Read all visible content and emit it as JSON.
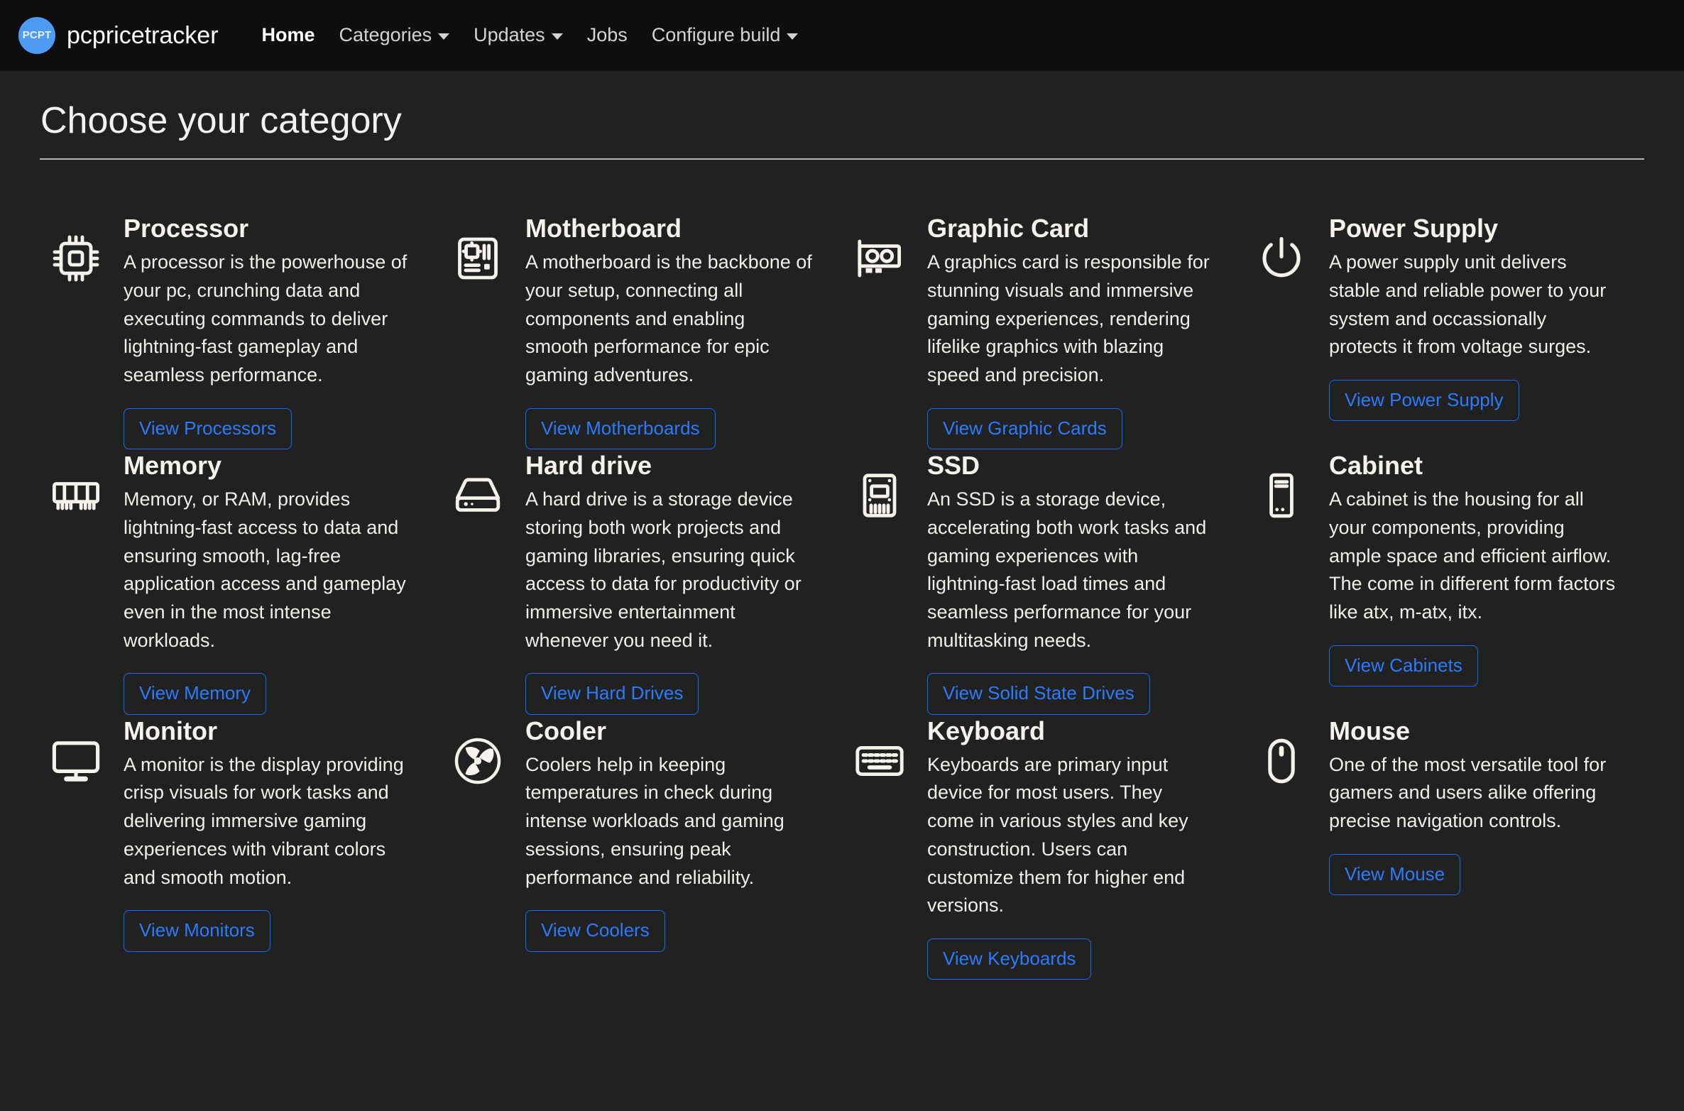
{
  "navbar": {
    "logo_text": "PCPT",
    "brand": "pcpricetracker",
    "logo_color": "#4d9bf5",
    "items": [
      {
        "label": "Home",
        "active": true,
        "dropdown": false
      },
      {
        "label": "Categories",
        "active": false,
        "dropdown": true
      },
      {
        "label": "Updates",
        "active": false,
        "dropdown": true
      },
      {
        "label": "Jobs",
        "active": false,
        "dropdown": false
      },
      {
        "label": "Configure build",
        "active": false,
        "dropdown": true
      }
    ]
  },
  "page": {
    "title": "Choose your category",
    "accent_color": "#0d6efd",
    "background": "#212121",
    "navbar_background": "#0e0e0e"
  },
  "categories": [
    {
      "icon": "cpu-icon",
      "title": "Processor",
      "description": "A processor is the powerhouse of your pc, crunching data and executing commands to deliver lightning-fast gameplay and seamless performance.",
      "button": "View Processors"
    },
    {
      "icon": "motherboard-icon",
      "title": "Motherboard",
      "description": "A motherboard is the backbone of your setup, connecting all components and enabling smooth performance for epic gaming adventures.",
      "button": "View Motherboards"
    },
    {
      "icon": "graphics-card-icon",
      "title": "Graphic Card",
      "description": "A graphics card is responsible for stunning visuals and immersive gaming experiences, rendering lifelike graphics with blazing speed and precision.",
      "button": "View Graphic Cards"
    },
    {
      "icon": "power-icon",
      "title": "Power Supply",
      "description": "A power supply unit delivers stable and reliable power to your system and occassionally protects it from voltage surges.",
      "button": "View Power Supply"
    },
    {
      "icon": "memory-ram-icon",
      "title": "Memory",
      "description": "Memory, or RAM, provides lightning-fast access to data and ensuring smooth, lag-free application access and gameplay even in the most intense workloads.",
      "button": "View Memory"
    },
    {
      "icon": "hard-drive-icon",
      "title": "Hard drive",
      "description": "A hard drive is a storage device storing both work projects and gaming libraries, ensuring quick access to data for productivity or immersive entertainment whenever you need it.",
      "button": "View Hard Drives"
    },
    {
      "icon": "ssd-icon",
      "title": "SSD",
      "description": "An SSD is a storage device, accelerating both work tasks and gaming experiences with lightning-fast load times and seamless performance for your multitasking needs.",
      "button": "View Solid State Drives"
    },
    {
      "icon": "pc-case-icon",
      "title": "Cabinet",
      "description": "A cabinet is the housing for all your components, providing ample space and efficient airflow. The come in different form factors like atx, m-atx, itx.",
      "button": "View Cabinets"
    },
    {
      "icon": "monitor-icon",
      "title": "Monitor",
      "description": "A monitor is the display providing crisp visuals for work tasks and delivering immersive gaming experiences with vibrant colors and smooth motion.",
      "button": "View Monitors"
    },
    {
      "icon": "fan-cooler-icon",
      "title": "Cooler",
      "description": "Coolers help in keeping temperatures in check during intense workloads and gaming sessions, ensuring peak performance and reliability.",
      "button": "View Coolers"
    },
    {
      "icon": "keyboard-icon",
      "title": "Keyboard",
      "description": "Keyboards are primary input device for most users. They come in various styles and key construction. Users can customize them for higher end versions.",
      "button": "View Keyboards"
    },
    {
      "icon": "mouse-icon",
      "title": "Mouse",
      "description": "One of the most versatile tool for gamers and users alike offering precise navigation controls.",
      "button": "View Mouse"
    }
  ]
}
